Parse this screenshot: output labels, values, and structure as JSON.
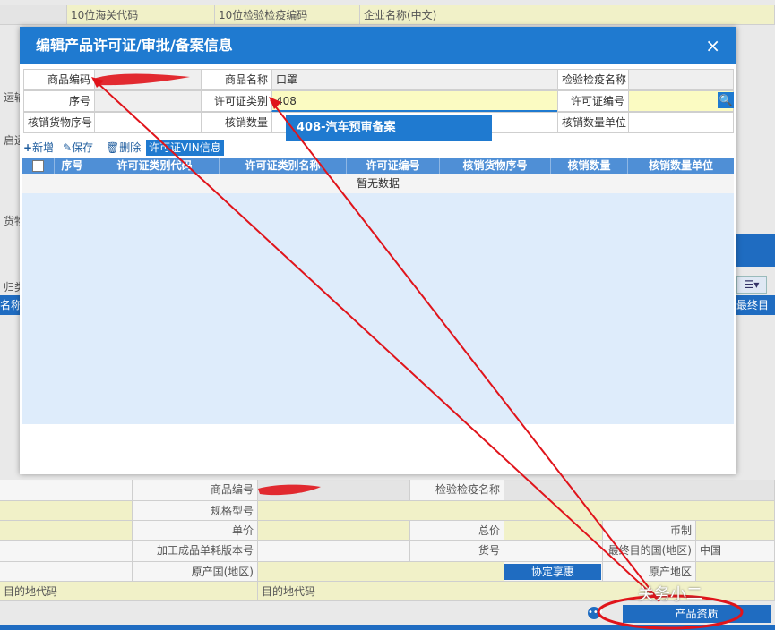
{
  "background": {
    "top_row": [
      "10位海关代码",
      "10位检验检疫编码",
      "企业名称(中文)"
    ],
    "side_labels": [
      "运输",
      "启运",
      "货物",
      "归类",
      "名称"
    ],
    "side_right": [
      "最终目的"
    ],
    "lower_rows": {
      "goods_code_label": "商品编号",
      "inspection_name_label": "检验检疫名称",
      "spec_model_label": "规格型号",
      "unit_price_label": "单价",
      "total_price_label": "总价",
      "currency_label": "币制",
      "processing_version_label": "加工成品单耗版本号",
      "item_no_label": "货号",
      "final_destination_label": "最终目的国(地区)",
      "final_destination_value": "中国",
      "origin_country_label": "原产国(地区)",
      "agreement_button": "协定享惠",
      "origin_area_label": "原产地区",
      "dest_code_label_left": "目的地代码",
      "dest_code_label_mid": "目的地代码",
      "product_qual_button": "产品资质"
    }
  },
  "modal": {
    "title": "编辑产品许可证/审批/备案信息",
    "close": "×",
    "fields": {
      "goods_code_label": "商品编码",
      "goods_name_label": "商品名称",
      "goods_name_value": "口罩",
      "inspection_name_label": "检验检疫名称",
      "seq_label": "序号",
      "license_type_label": "许可证类别",
      "license_type_value": "408",
      "license_no_label": "许可证编号",
      "writeoff_seq_label": "核销货物序号",
      "writeoff_qty_label": "核销数量",
      "writeoff_unit_label": "核销数量单位"
    },
    "dropdown_option": "408-汽车预审备案",
    "toolbar": {
      "add": "新增",
      "save": "保存",
      "delete": "删除",
      "vin": "许可证VIN信息"
    },
    "grid": {
      "columns": [
        "序号",
        "许可证类别代码",
        "许可证类别名称",
        "许可证编号",
        "核销货物序号",
        "核销数量",
        "核销数量单位"
      ],
      "empty_text": "暂无数据"
    }
  },
  "watermark": "关务小二",
  "colors": {
    "header_blue": "#1f7ad0",
    "highlight_yellow": "#fbfbc2",
    "annotation_red": "#e0141b"
  }
}
